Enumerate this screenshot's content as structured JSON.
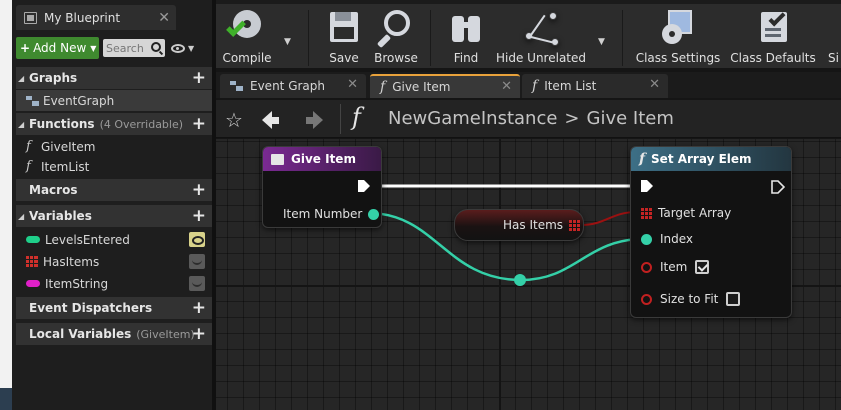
{
  "my_blueprint": {
    "tab_title": "My Blueprint",
    "add_new_label": "Add New",
    "search_placeholder": "Search",
    "sections": {
      "graphs": {
        "title": "Graphs",
        "items": [
          "EventGraph"
        ]
      },
      "functions": {
        "title": "Functions",
        "subtitle": "(4 Overridable)",
        "items": [
          "GiveItem",
          "ItemList"
        ]
      },
      "macros": {
        "title": "Macros"
      },
      "variables": {
        "title": "Variables",
        "items": [
          {
            "name": "LevelsEntered",
            "type_color": "#1fcf8a",
            "visible": true
          },
          {
            "name": "HasItems",
            "type_color": "#d0302b",
            "visible": false
          },
          {
            "name": "ItemString",
            "type_color": "#e020c8",
            "visible": false
          }
        ]
      },
      "event_dispatchers": {
        "title": "Event Dispatchers"
      },
      "local_variables": {
        "title": "Local Variables",
        "subtitle": "(GiveItem)"
      }
    }
  },
  "toolbar": {
    "compile": "Compile",
    "save": "Save",
    "browse": "Browse",
    "find": "Find",
    "hide_unrelated": "Hide Unrelated",
    "class_settings": "Class Settings",
    "class_defaults": "Class Defaults",
    "partial_next": "Si"
  },
  "doc_tabs": [
    {
      "label": "Event Graph",
      "active": false
    },
    {
      "label": "Give Item",
      "active": true
    },
    {
      "label": "Item List",
      "active": false
    }
  ],
  "breadcrumb": {
    "root": "NewGameInstance",
    "separator": ">",
    "current": "Give Item"
  },
  "graph": {
    "entry_node": {
      "title": "Give Item",
      "header_color": "#7a2a92",
      "output_pin": "Item Number"
    },
    "has_items_node": {
      "label": "Has Items"
    },
    "set_array_node": {
      "title": "Set Array Elem",
      "header_color": "#3d6f86",
      "pins": [
        "Target Array",
        "Index",
        "Item",
        "Size to Fit"
      ],
      "item_checked": true,
      "size_to_fit_checked": false
    }
  },
  "colors": {
    "exec_wire": "#ffffff",
    "int_wire": "#34d0a8",
    "array_wire": "#9b1111",
    "add_new_green": "#3f8a2f",
    "active_tab_accent": "#e9a23b"
  }
}
